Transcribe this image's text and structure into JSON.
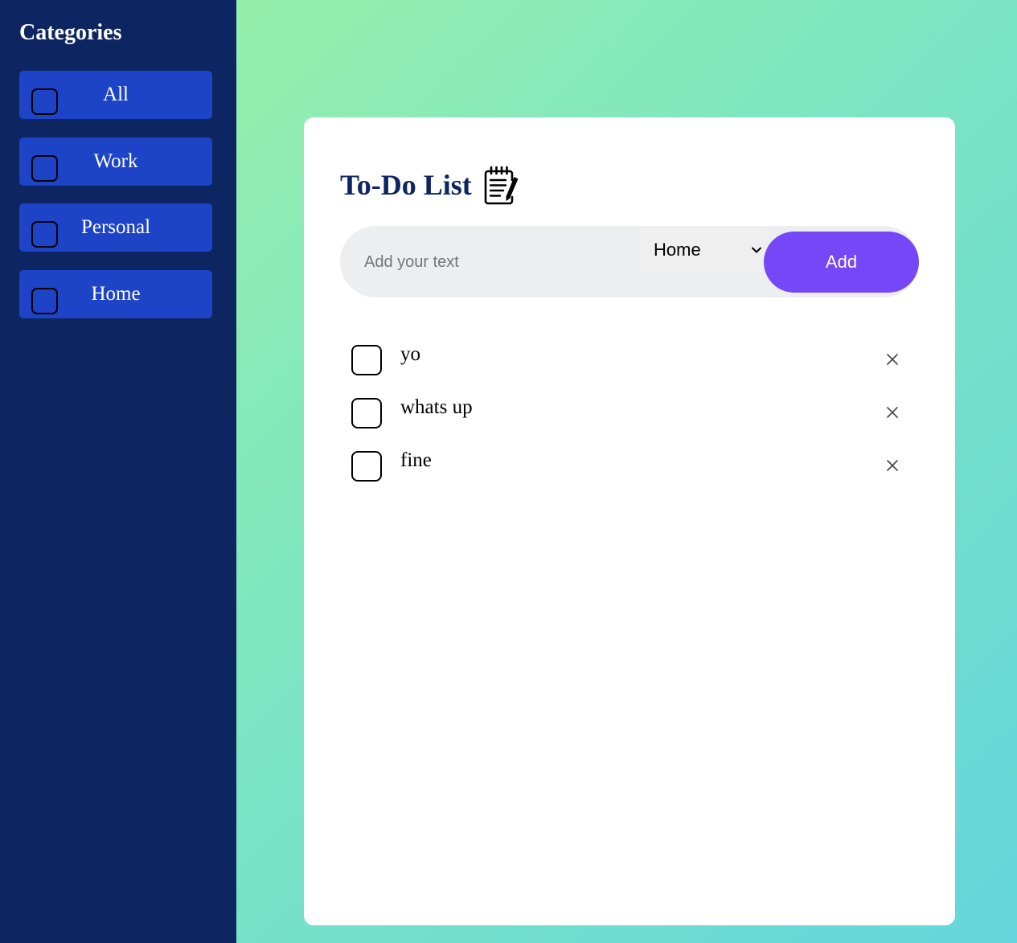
{
  "sidebar": {
    "title": "Categories",
    "items": [
      {
        "label": "All"
      },
      {
        "label": "Work"
      },
      {
        "label": "Personal"
      },
      {
        "label": "Home"
      }
    ]
  },
  "main": {
    "title": "To-Do List",
    "title_icon": "notepad-icon",
    "input": {
      "value": "",
      "placeholder": "Add your text"
    },
    "category_select": {
      "selected": "Home"
    },
    "add_label": "Add",
    "todos": [
      {
        "text": "yo",
        "checked": false
      },
      {
        "text": "whats up",
        "checked": false
      },
      {
        "text": "fine",
        "checked": false
      }
    ]
  },
  "colors": {
    "sidebar_bg": "#0d2561",
    "category_button": "#1d43c7",
    "accent": "#7647f7",
    "title": "#0d2561",
    "gradient_start": "#9df3a3",
    "gradient_end": "#63d6db"
  }
}
